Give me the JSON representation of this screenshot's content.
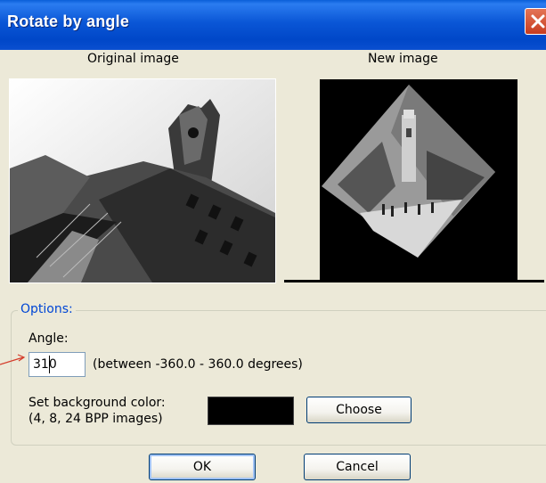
{
  "window": {
    "title": "Rotate by angle"
  },
  "preview": {
    "original_label": "Original image",
    "new_label": "New image"
  },
  "options": {
    "group_label": "Options:",
    "angle_label": "Angle:",
    "angle_value": "310",
    "angle_range_text": "(between -360.0  -  360.0 degrees)",
    "bg_color_label_line1": "Set background color:",
    "bg_color_label_line2": "(4, 8, 24 BPP images)",
    "bg_color": "#000000",
    "choose_label": "Choose"
  },
  "buttons": {
    "ok_label": "OK",
    "cancel_label": "Cancel"
  },
  "colors": {
    "titlebar": "#0a56d6",
    "dialog_bg": "#ece9d8",
    "group_label": "#0046d5",
    "annotation_arrow": "#d43c2b"
  }
}
